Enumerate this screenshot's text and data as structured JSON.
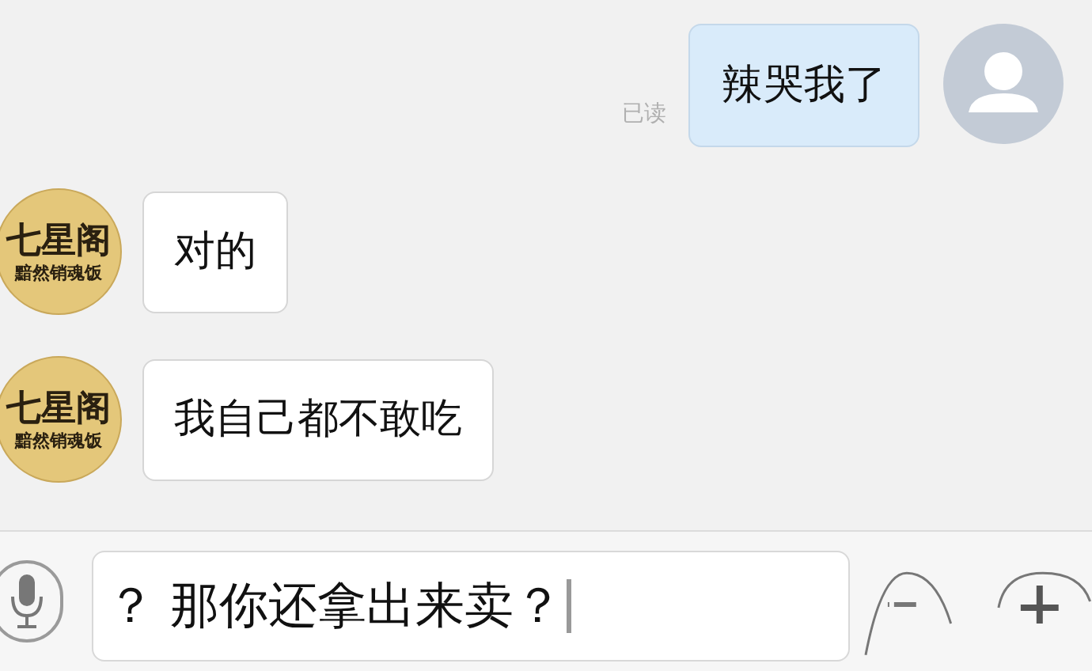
{
  "messages": [
    {
      "kind": "outgoing",
      "text": "辣哭我了",
      "status": "已读"
    },
    {
      "kind": "incoming",
      "text": "对的",
      "avatar": {
        "name": "七星阁",
        "tagline": "黯然销魂饭"
      }
    },
    {
      "kind": "incoming",
      "text": "我自己都不敢吃",
      "avatar": {
        "name": "七星阁",
        "tagline": "黯然销魂饭"
      }
    }
  ],
  "input": {
    "value": "？ 那你还拿出来卖？"
  }
}
